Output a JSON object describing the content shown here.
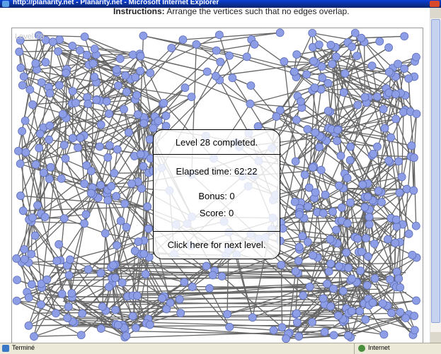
{
  "window": {
    "title": "http://planarity.net - Planarity.net - Microsoft Internet Explorer"
  },
  "page": {
    "instructions_label": "Instructions:",
    "instructions_text": " Arrange the vertices such that no edges overlap."
  },
  "game": {
    "level_label": "Level 28",
    "node_color": "#8d9ee6",
    "edge_color": "#666666"
  },
  "dialog": {
    "title": "Level 28 completed.",
    "elapsed_time": "Elapsed time: 62:22",
    "bonus": "Bonus: 0",
    "score": "Score: 0",
    "next_level": "Click here for next level."
  },
  "statusbar": {
    "status": "Terminé",
    "zone": "Internet"
  }
}
